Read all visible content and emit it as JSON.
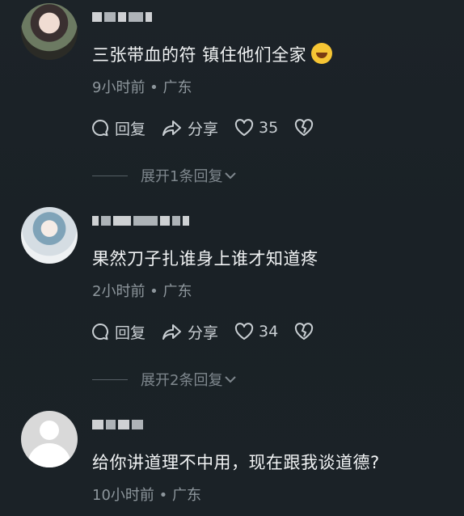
{
  "comments": [
    {
      "text": "三张带血的符 镇住他们全家",
      "meta": "9小时前 • 广东",
      "reply_label": "回复",
      "share_label": "分享",
      "likes": "35",
      "expand_label": "展开1条回复"
    },
    {
      "text": "果然刀子扎谁身上谁才知道疼",
      "meta": "2小时前 • 广东",
      "reply_label": "回复",
      "share_label": "分享",
      "likes": "34",
      "expand_label": "展开2条回复"
    },
    {
      "text": "给你讲道理不中用，现在跟我谈道德?",
      "meta": "10小时前 • 广东"
    }
  ],
  "icons": {
    "reply": "comment-bubble-icon",
    "share": "share-arrow-icon",
    "like": "heart-icon",
    "dislike": "broken-heart-icon",
    "expand": "chevron-down-icon",
    "emoji": "laughing-tears-emoji-icon"
  },
  "colors": {
    "background": "#1c2328",
    "text": "#f1f3f4",
    "meta": "#8d969c"
  }
}
